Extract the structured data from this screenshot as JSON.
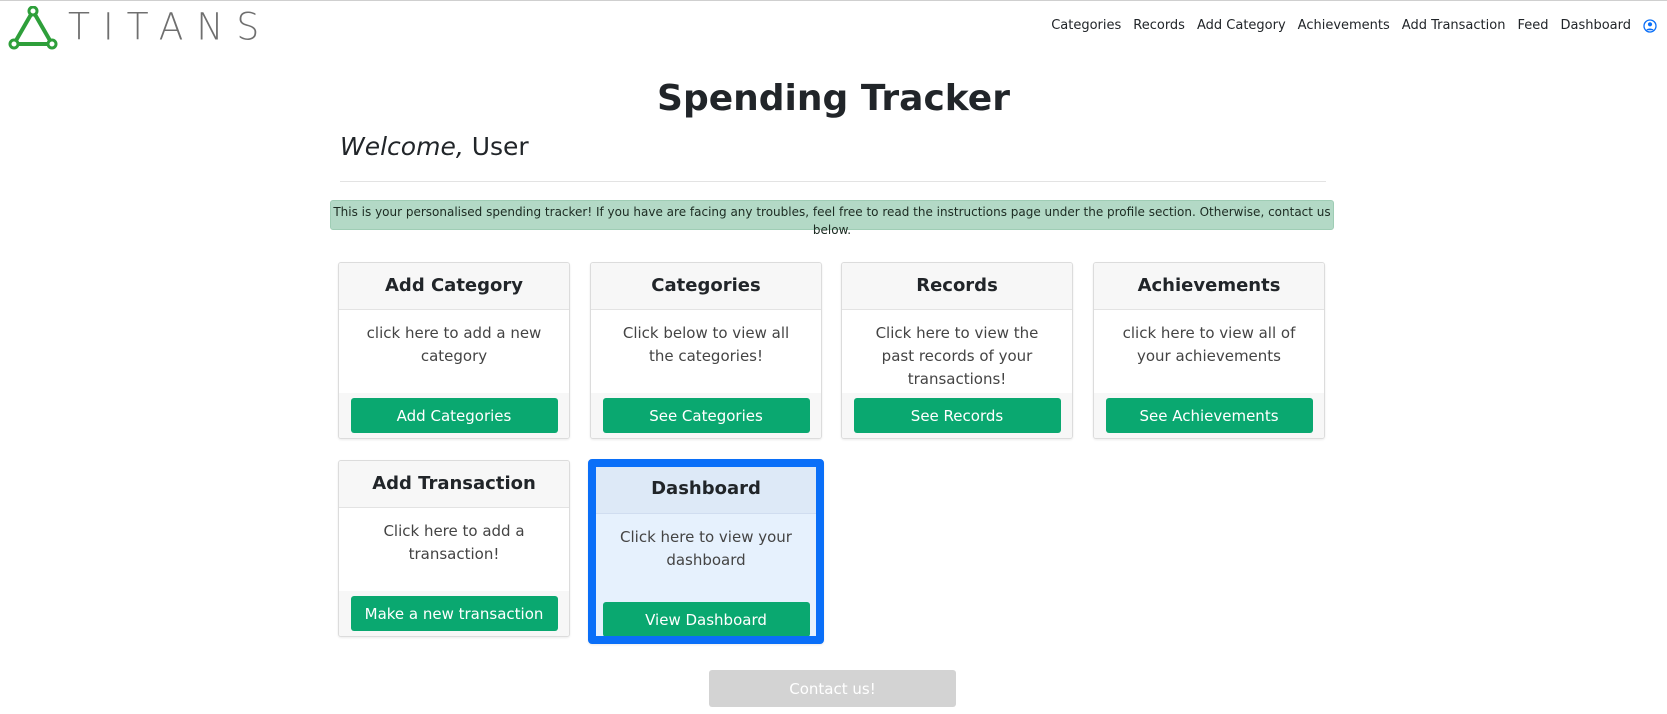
{
  "brand": {
    "name": "TITANS",
    "accent": "#2e9f3a"
  },
  "nav": {
    "links": [
      "Categories",
      "Records",
      "Add Category",
      "Achievements",
      "Add Transaction",
      "Feed",
      "Dashboard"
    ],
    "profile_icon": "user-circle-icon"
  },
  "page": {
    "title": "Spending Tracker",
    "welcome_prefix": "Welcome,",
    "welcome_user": " User",
    "alert": "This is your personalised spending tracker! If you have are facing any troubles, feel free to read the instructions page under the profile section. Otherwise, contact us below."
  },
  "cards": [
    {
      "title": "Add Category",
      "text": "click here to add a new category",
      "button": "Add Categories"
    },
    {
      "title": "Categories",
      "text": "Click below to view all the categories!",
      "button": "See Categories"
    },
    {
      "title": "Records",
      "text": "Click here to view the past records of your transactions!",
      "button": "See Records"
    },
    {
      "title": "Achievements",
      "text": "click here to view all of your achievements",
      "button": "See Achievements"
    },
    {
      "title": "Add Transaction",
      "text": "Click here to add a transaction!",
      "button": "Make a new transaction"
    },
    {
      "title": "Dashboard",
      "text": "Click here to view your dashboard",
      "button": "View Dashboard"
    }
  ],
  "contact_button": "Contact us!",
  "colors": {
    "button": "#0aa870",
    "alert_bg": "#b3d9c6",
    "highlight": "#0a6ff8"
  }
}
